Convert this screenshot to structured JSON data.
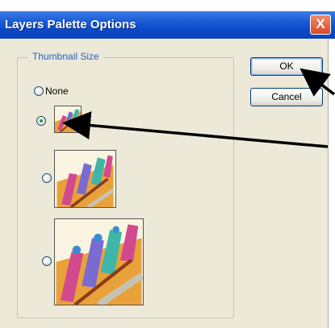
{
  "dialog": {
    "title": "Layers Palette Options",
    "close_label": "X"
  },
  "thumbnail_group": {
    "label": "Thumbnail Size",
    "options": [
      {
        "label": "None",
        "selected": false
      },
      {
        "label": "",
        "size": "small",
        "selected": true
      },
      {
        "label": "",
        "size": "medium",
        "selected": false
      },
      {
        "label": "",
        "size": "large",
        "selected": false
      }
    ]
  },
  "buttons": {
    "ok": "OK",
    "cancel": "Cancel"
  },
  "colors": {
    "title_bar": "#0a48c8",
    "dialog_bg": "#ece9d8",
    "group_label": "#2c5fbd",
    "close_button": "#d9482a"
  }
}
